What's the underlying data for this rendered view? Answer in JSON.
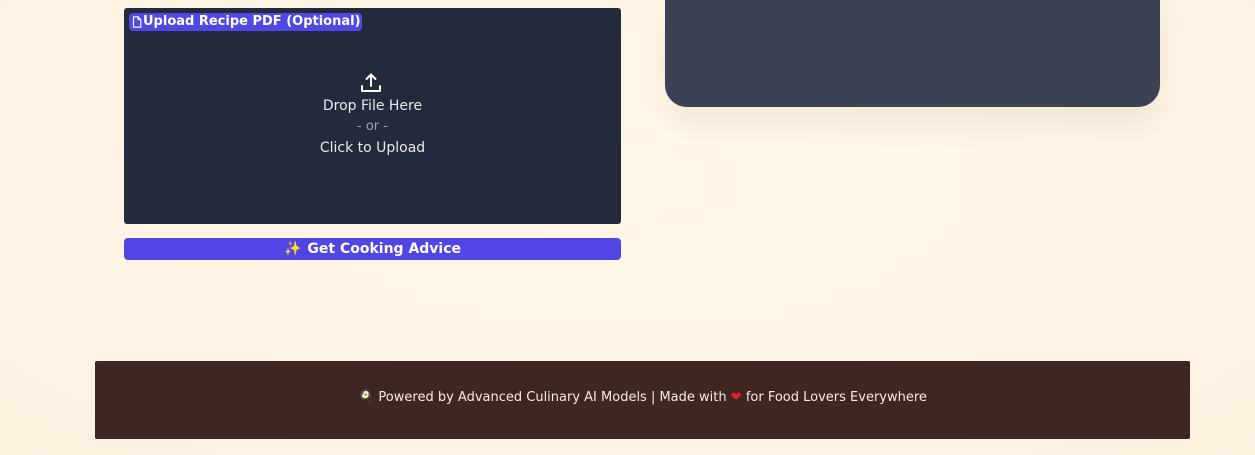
{
  "upload": {
    "label": "Upload Recipe PDF (Optional)",
    "label_icon": "file-icon",
    "drop_icon": "upload-icon",
    "drop_text": "Drop File Here",
    "or_text": "- or -",
    "click_text": "Click to Upload"
  },
  "action": {
    "icon": "sparkles-icon",
    "sparkle_glyph": "✨",
    "button_label": "Get Cooking Advice"
  },
  "footer": {
    "icon": "frying-pan-icon",
    "pan_glyph": "🍳",
    "text_before": "Powered by Advanced Culinary AI Models | Made with",
    "heart_glyph": "❤",
    "text_after": "for Food Lovers Everywhere"
  },
  "colors": {
    "background": "#fdf5e6",
    "upload_panel": "#222a3b",
    "accent": "#5046e5",
    "output_card": "#3a4254",
    "footer": "#3f2622"
  }
}
